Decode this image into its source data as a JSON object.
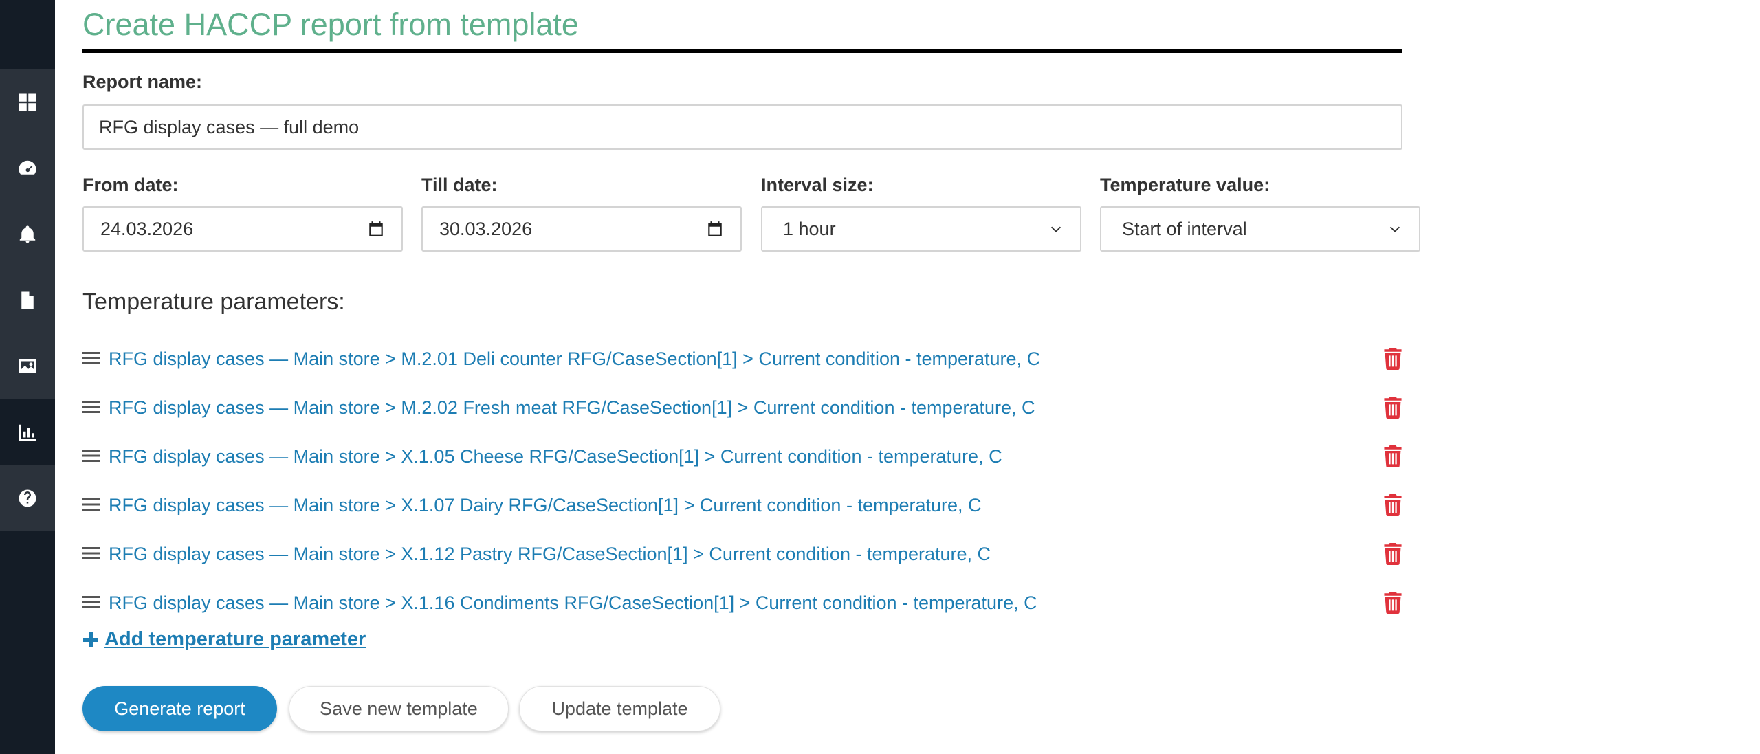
{
  "sidebar": {
    "items": [
      {
        "name": "dashboard-icon"
      },
      {
        "name": "gauge-icon"
      },
      {
        "name": "bell-icon"
      },
      {
        "name": "file-icon"
      },
      {
        "name": "image-icon"
      },
      {
        "name": "chart-icon",
        "active": true
      },
      {
        "name": "help-icon"
      }
    ]
  },
  "page": {
    "title": "Create HACCP report from template"
  },
  "form": {
    "report_name_label": "Report name:",
    "report_name_value": "RFG display cases — full demo",
    "from_date_label": "From date:",
    "from_date_value": "24.03.2026",
    "till_date_label": "Till date:",
    "till_date_value": "30.03.2026",
    "interval_label": "Interval size:",
    "interval_value": "1 hour",
    "temp_value_label": "Temperature value:",
    "temp_value_value": "Start of interval"
  },
  "parameters": {
    "heading": "Temperature parameters:",
    "items": [
      {
        "label": "RFG display cases — Main store > M.2.01 Deli counter RFG/CaseSection[1] > Current condition - temperature, C"
      },
      {
        "label": "RFG display cases — Main store > M.2.02 Fresh meat RFG/CaseSection[1] > Current condition - temperature, C"
      },
      {
        "label": "RFG display cases — Main store > X.1.05 Cheese RFG/CaseSection[1] > Current condition - temperature, C"
      },
      {
        "label": "RFG display cases — Main store > X.1.07 Dairy RFG/CaseSection[1] > Current condition - temperature, C"
      },
      {
        "label": "RFG display cases — Main store > X.1.12 Pastry RFG/CaseSection[1] > Current condition - temperature, C"
      },
      {
        "label": "RFG display cases — Main store > X.1.16 Condiments RFG/CaseSection[1] > Current condition - temperature, C"
      }
    ],
    "add_label": "Add temperature parameter"
  },
  "actions": {
    "generate_label": "Generate report",
    "save_label": "Save new template",
    "update_label": "Update template"
  },
  "colors": {
    "title": "#5fb08c",
    "link": "#1d7db3",
    "primary_button": "#1e88c4",
    "delete": "#e0323c",
    "sidebar": "#141c26"
  }
}
